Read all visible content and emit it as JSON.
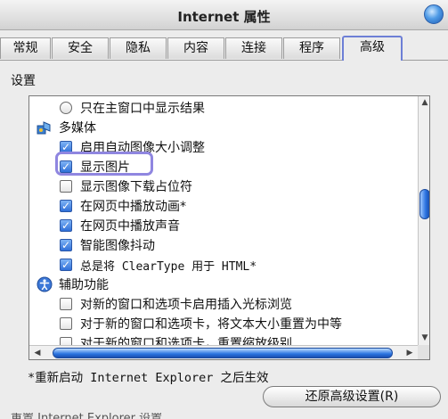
{
  "window": {
    "title": "Internet 属性"
  },
  "tabs": [
    {
      "label": "常规"
    },
    {
      "label": "安全"
    },
    {
      "label": "隐私"
    },
    {
      "label": "内容"
    },
    {
      "label": "连接"
    },
    {
      "label": "程序"
    },
    {
      "label": "高级",
      "active": true
    }
  ],
  "panel": {
    "label": "设置"
  },
  "settings": [
    {
      "label": "只在主窗口中显示结果",
      "kind": "radio",
      "checked": false
    },
    {
      "label": "多媒体",
      "kind": "category",
      "icon": "multimedia-icon"
    },
    {
      "label": "启用自动图像大小调整",
      "kind": "checkbox",
      "checked": true
    },
    {
      "label": "显示图片",
      "kind": "checkbox",
      "checked": true
    },
    {
      "label": "显示图像下载占位符",
      "kind": "checkbox",
      "checked": false
    },
    {
      "label": "在网页中播放动画*",
      "kind": "checkbox",
      "checked": true
    },
    {
      "label": "在网页中播放声音",
      "kind": "checkbox",
      "checked": true
    },
    {
      "label": "智能图像抖动",
      "kind": "checkbox",
      "checked": true
    },
    {
      "label": "总是将 ClearType 用于 HTML*",
      "kind": "checkbox",
      "checked": true
    },
    {
      "label": "辅助功能",
      "kind": "category",
      "icon": "accessibility-icon"
    },
    {
      "label": "对新的窗口和选项卡启用插入光标浏览",
      "kind": "checkbox",
      "checked": false
    },
    {
      "label": "对于新的窗口和选项卡，将文本大小重置为中等",
      "kind": "checkbox",
      "checked": false
    },
    {
      "label": "对于新的窗口和选项卡，重置缩放级别",
      "kind": "checkbox",
      "checked": false
    }
  ],
  "note": "*重新启动 Internet Explorer 之后生效",
  "buttons": {
    "restore": "还原高级设置(R)"
  },
  "footer_partial": "重置 Internet Explorer 设置",
  "colors": {
    "highlight": "#8f86e0",
    "checkbox_checked": "#2f6fd8",
    "scroll_thumb": "#2a73e0"
  }
}
